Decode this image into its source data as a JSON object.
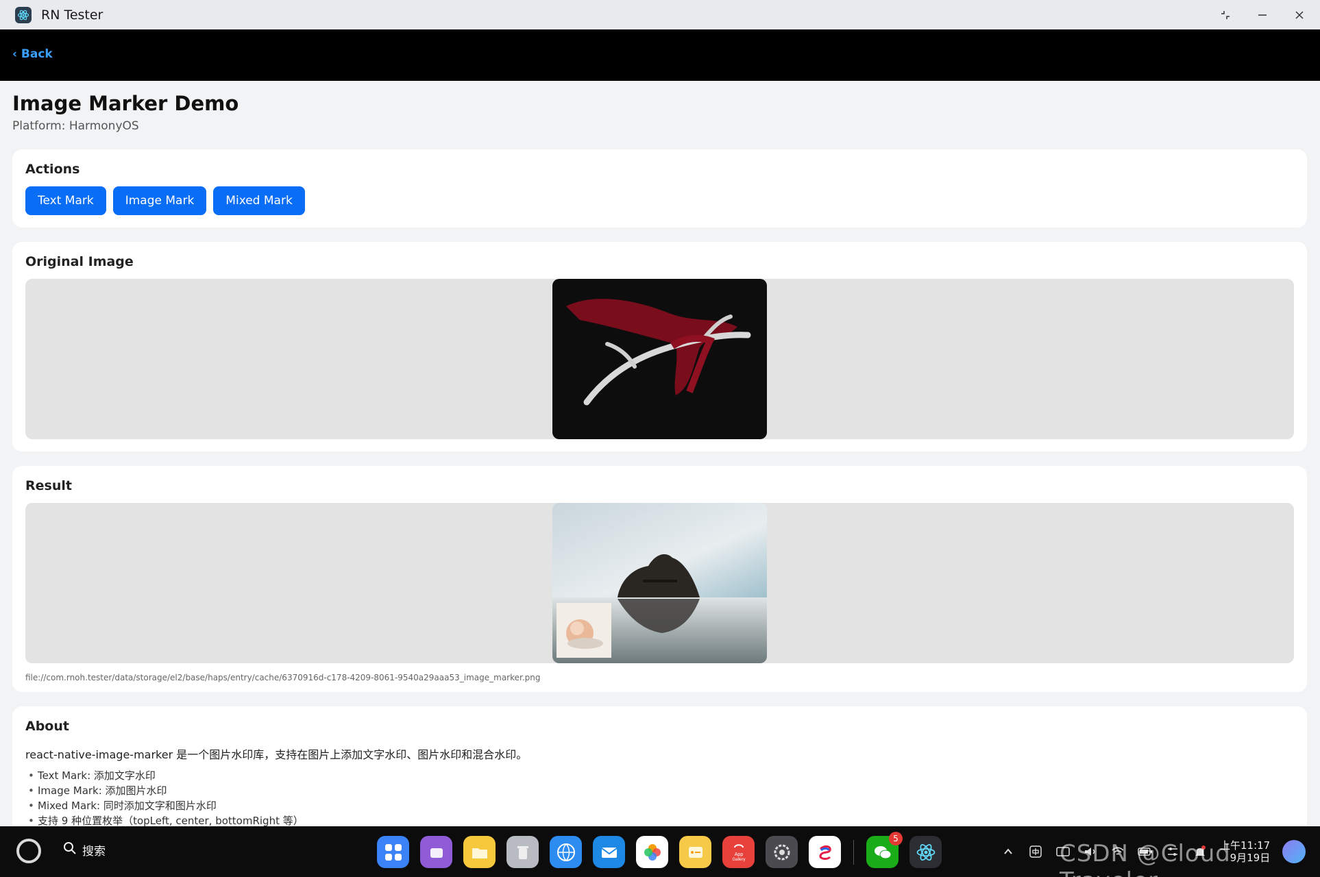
{
  "window": {
    "title": "RN Tester"
  },
  "header": {
    "back_label": "‹ Back"
  },
  "page": {
    "title": "Image Marker Demo",
    "subtitle": "Platform: HarmonyOS"
  },
  "actions": {
    "title": "Actions",
    "buttons": [
      "Text Mark",
      "Image Mark",
      "Mixed Mark"
    ]
  },
  "original": {
    "title": "Original Image"
  },
  "result": {
    "title": "Result",
    "path": "file://com.rnoh.tester/data/storage/el2/base/haps/entry/cache/6370916d-c178-4209-8061-9540a29aaa53_image_marker.png"
  },
  "about": {
    "title": "About",
    "description": "react-native-image-marker 是一个图片水印库，支持在图片上添加文字水印、图片水印和混合水印。",
    "items": [
      "Text Mark: 添加文字水印",
      "Image Mark: 添加图片水印",
      "Mixed Mark: 同时添加文字和图片水印",
      "支持 9 种位置枚举（topLeft, center, bottomRight 等）"
    ]
  },
  "taskbar": {
    "search_label": "搜索",
    "wechat_badge": "5",
    "clock_time": "上午11:17",
    "clock_date": "9月19日"
  },
  "watermark": "CSDN @Cloud Traveler",
  "colors": {
    "accent": "#0a6df5",
    "header_bg": "#000000",
    "back_link": "#3aa0ff"
  }
}
